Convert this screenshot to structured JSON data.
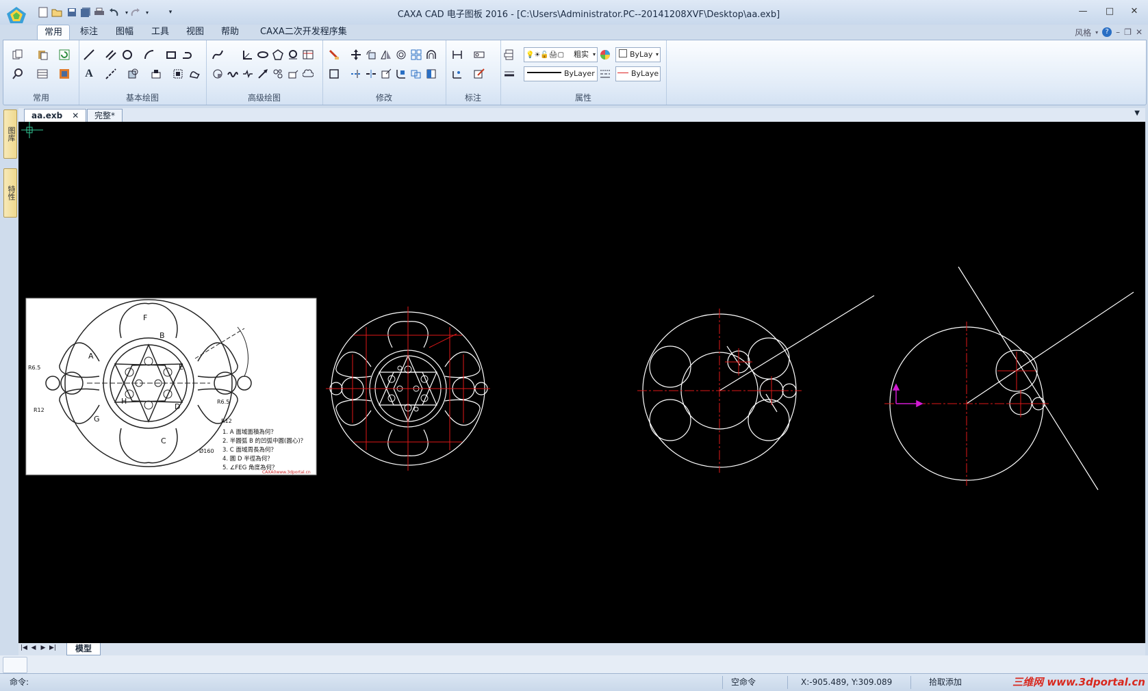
{
  "window": {
    "title": "CAXA CAD 电子图板 2016 - [C:\\Users\\Administrator.PC--20141208XVF\\Desktop\\aa.exb]",
    "controls": [
      "—",
      "□",
      "✕"
    ]
  },
  "ribbon_tabs": [
    "常用",
    "标注",
    "图幅",
    "工具",
    "视图",
    "帮助",
    "CAXA二次开发程序集"
  ],
  "ribbon_right": {
    "style_label": "风格",
    "help_icon": "?"
  },
  "ribbon_groups": [
    "常用",
    "基本绘图",
    "高级绘图",
    "修改",
    "标注",
    "属性"
  ],
  "properties": {
    "layer_value": "粗实",
    "color_value": "ByLay",
    "linetype_value": "ByLayer",
    "lineweight_value": "ByLaye"
  },
  "side_tabs": [
    "图库",
    "特性"
  ],
  "doc_tabs": [
    "aa.exb",
    "完整*"
  ],
  "layout_tab": "模型",
  "reference_image": {
    "labels": [
      "F",
      "B",
      "A",
      "E",
      "R6.5",
      "R12",
      "G",
      "H",
      "D",
      "C",
      "R6.5",
      "R12",
      "Ø160"
    ],
    "questions": [
      "1. A 面域面積為何？",
      "2. 半圓弧 B 的凹弧中圓(圓心)？",
      "3. C 面域周長為何？",
      "4. 圓 D 半徑為何？",
      "5. ∠FEG 角度為何？"
    ],
    "footer": "CAXA0www.3dportal.cn"
  },
  "status": {
    "command_prompt": "命令:",
    "command_state": "空命令",
    "coordinates": "X:-905.489, Y:309.089",
    "mode": "拾取添加",
    "watermark": "三维网 www.3dportal.cn"
  }
}
